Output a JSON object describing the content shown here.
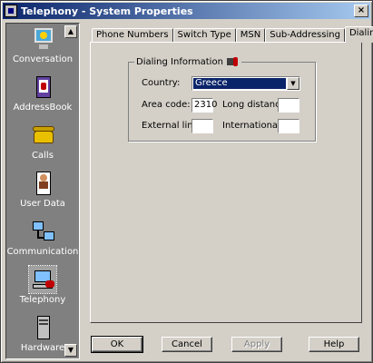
{
  "window": {
    "title": "Telephony - System Properties",
    "close_glyph": "×"
  },
  "sidebar": {
    "items": [
      {
        "label": "Conversation",
        "icon": "monitor-icon"
      },
      {
        "label": "AddressBook",
        "icon": "address-book-icon"
      },
      {
        "label": "Calls",
        "icon": "telephone-icon"
      },
      {
        "label": "User Data",
        "icon": "user-card-icon"
      },
      {
        "label": "Communication",
        "icon": "network-icon"
      },
      {
        "label": "Telephony",
        "icon": "computer-phone-icon",
        "selected": true
      },
      {
        "label": "Hardware",
        "icon": "tower-pc-icon"
      }
    ],
    "scroll_up_glyph": "▲",
    "scroll_down_glyph": "▼"
  },
  "tabs": [
    {
      "label": "Phone Numbers"
    },
    {
      "label": "Switch Type"
    },
    {
      "label": "MSN"
    },
    {
      "label": "Sub-Addressing"
    },
    {
      "label": "Dialing",
      "active": true
    }
  ],
  "dialing": {
    "group_title": "Dialing Information",
    "country_label": "Country:",
    "country_value": "Greece",
    "combo_arrow": "▼",
    "area_code_label": "Area code:",
    "area_code_value": "2310",
    "long_distance_label": "Long distance:",
    "long_distance_value": "",
    "external_line_label": "External line:",
    "external_line_value": "",
    "international_label": "International:",
    "international_value": ""
  },
  "buttons": {
    "ok": "OK",
    "cancel": "Cancel",
    "apply": "Apply",
    "help": "Help"
  },
  "colors": {
    "titlebar_start": "#0a246a",
    "titlebar_end": "#a6caf0",
    "face": "#d4d0c8",
    "sidebar_bg": "#808080"
  }
}
